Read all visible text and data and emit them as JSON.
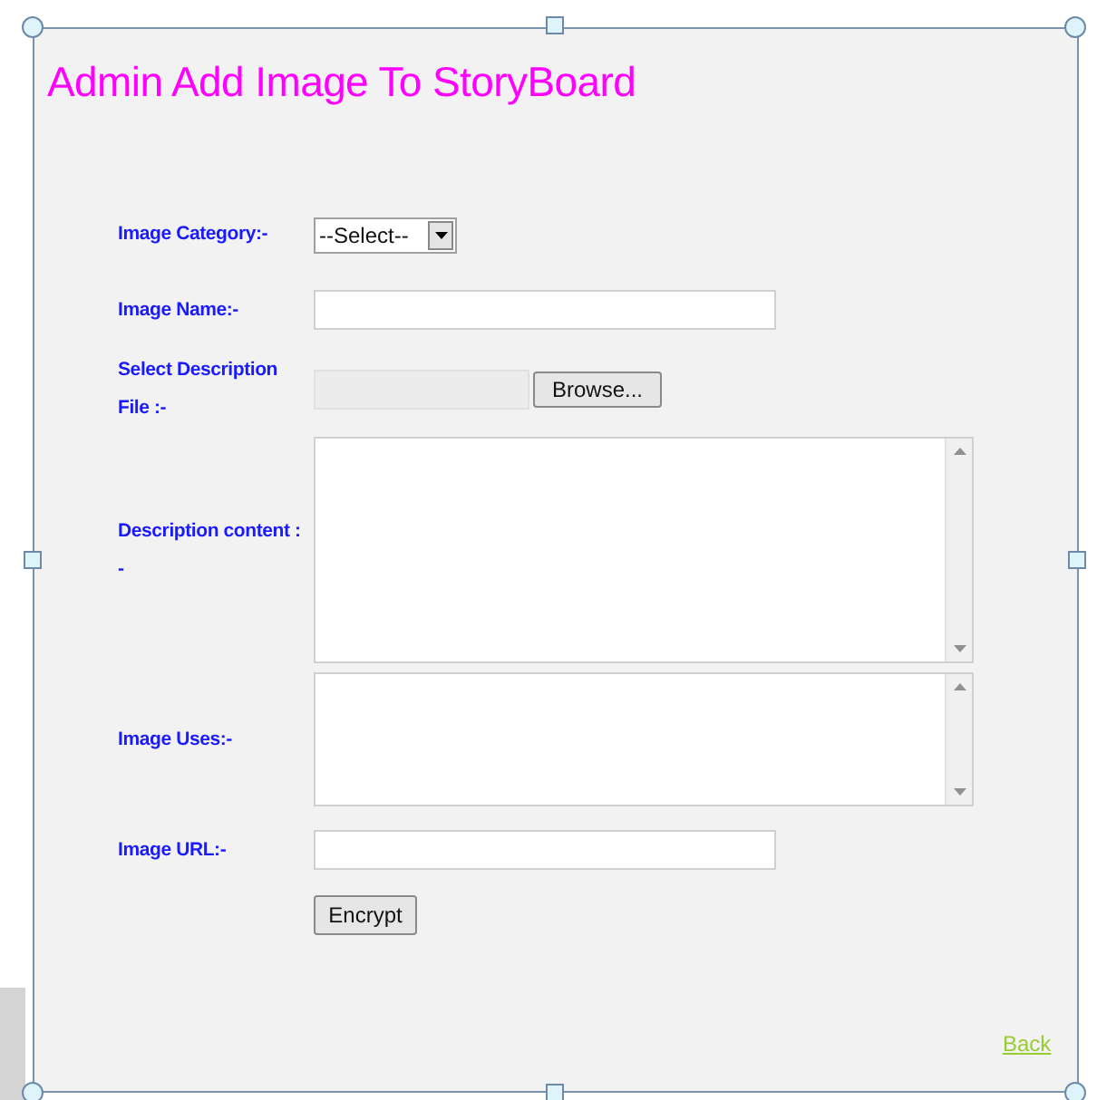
{
  "title": "Admin Add Image To StoryBoard",
  "fields": [
    {
      "kind": "select",
      "label": "Image Category:-",
      "value": "--Select--"
    },
    {
      "kind": "text",
      "label": "Image Name:-"
    },
    {
      "kind": "file",
      "label": "Select Description File :-",
      "button": "Browse..."
    },
    {
      "kind": "textarea",
      "label": "Description content : -"
    },
    {
      "kind": "textarea",
      "label": "Image Uses:-"
    },
    {
      "kind": "text",
      "label": "Image URL:-"
    }
  ],
  "submit": "Encrypt",
  "back_link": "Back"
}
